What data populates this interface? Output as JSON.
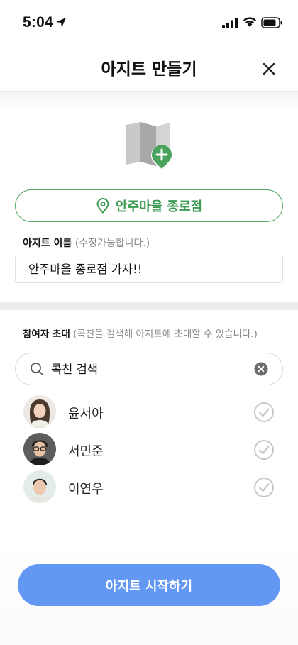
{
  "status_bar": {
    "time": "5:04"
  },
  "header": {
    "title": "아지트 만들기"
  },
  "location": {
    "label": "안주마을 종로점"
  },
  "name_section": {
    "label": "아지트 이름",
    "hint": "(수정가능합니다.)",
    "value": "안주마을 종로점 가자!!"
  },
  "invite_section": {
    "label": "참여자 초대",
    "hint": "(콕친을 검색해 아지트에 초대할 수 있습니다.)"
  },
  "search": {
    "value": "콕친 검색"
  },
  "friends": [
    {
      "name": "윤서아"
    },
    {
      "name": "서민준"
    },
    {
      "name": "이연우"
    }
  ],
  "cta": {
    "label": "아지트 시작하기"
  },
  "colors": {
    "accent_green": "#3c9a52",
    "primary_blue": "#6297f3"
  }
}
